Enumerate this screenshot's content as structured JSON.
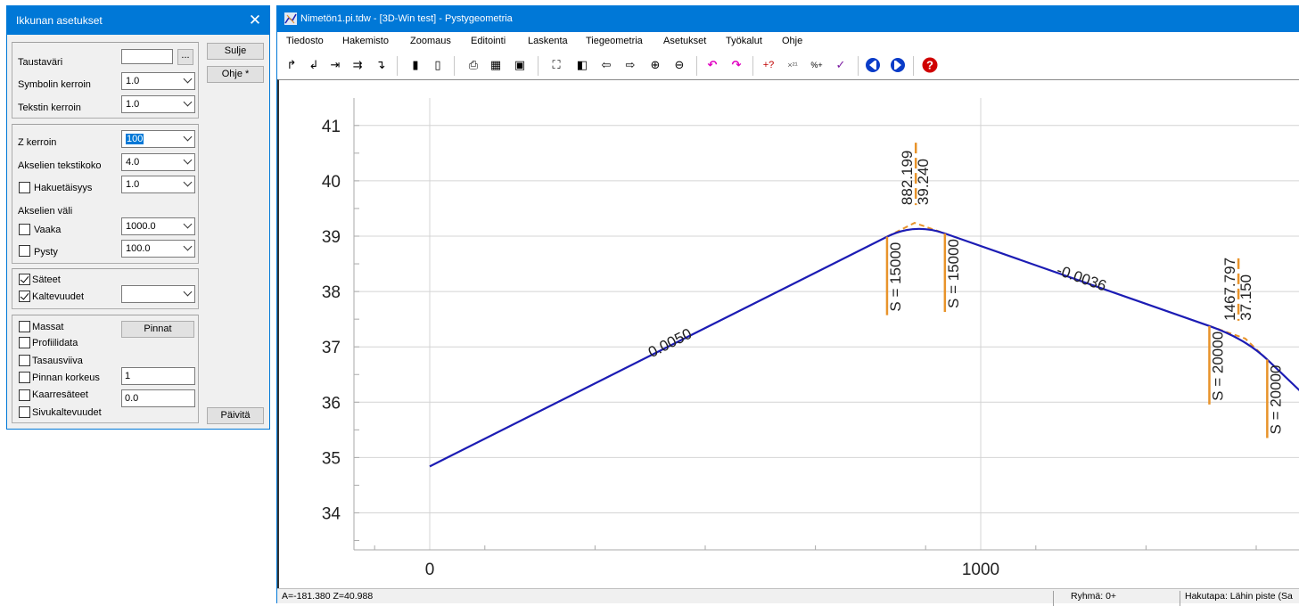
{
  "dialog": {
    "title": "Ikkunan asetukset",
    "close_glyph": "✕",
    "buttons": {
      "close": "Sulje",
      "help": "Ohje *",
      "surfaces": "Pinnat",
      "update": "Päivitä"
    },
    "fields": {
      "background_color": {
        "label": "Taustaväri",
        "browse": "..."
      },
      "symbol_factor": {
        "label": "Symbolin kerroin",
        "value": "1.0"
      },
      "text_factor": {
        "label": "Tekstin kerroin",
        "value": "1.0"
      },
      "z_factor": {
        "label": "Z kerroin",
        "value": "100"
      },
      "axis_text_size": {
        "label": "Akselien tekstikoko",
        "value": "4.0"
      },
      "search_distance": {
        "label": "Hakuetäisyys",
        "value": "1.0",
        "checked": false
      },
      "axis_spacing_label": "Akselien väli",
      "horizontal": {
        "label": "Vaaka",
        "value": "1000.0",
        "checked": false
      },
      "vertical": {
        "label": "Pysty",
        "value": "100.0",
        "checked": false
      },
      "radii": {
        "label": "Säteet",
        "checked": true
      },
      "grades": {
        "label": "Kaltevuudet",
        "value": "",
        "checked": true
      },
      "masses": {
        "label": "Massat",
        "checked": false
      },
      "profile_data": {
        "label": "Profiilidata",
        "checked": false
      },
      "levelling_line": {
        "label": "Tasausviiva",
        "checked": false
      },
      "surface_height": {
        "label": "Pinnan korkeus",
        "value": "1",
        "checked": false
      },
      "arc_radii": {
        "label": "Kaarresäteet",
        "value": "0.0",
        "checked": false
      },
      "side_grades": {
        "label": "Sivukaltevuudet",
        "checked": false
      }
    }
  },
  "window": {
    "title": "Nimetön1.pi.tdw - [3D-Win test] - Pystygeometria",
    "menu": [
      "Tiedosto",
      "Hakemisto",
      "Zoomaus",
      "Editointi",
      "Laskenta",
      "Tiegeometria",
      "Asetukset",
      "Työkalut",
      "Ohje"
    ],
    "status": {
      "coords": "A=-181.380  Z=40.988",
      "group": "Ryhmä: 0+",
      "snap": "Hakutapa: Lähin piste (Sa"
    }
  },
  "colors": {
    "accent": "#0078d7",
    "alignment": "#1c1cb4",
    "annotation": "#e8932a",
    "help_icon": "#d00000",
    "undo": "#e000c0"
  },
  "chart_data": {
    "type": "line",
    "x": [
      0,
      880,
      1480,
      1580
    ],
    "y": [
      34.84,
      39.24,
      37.15,
      36.2
    ],
    "xlim": [
      -140,
      1580
    ],
    "ylim": [
      33.3,
      41.3
    ],
    "xticks": [
      0,
      1000
    ],
    "yticks": [
      34,
      35,
      36,
      37,
      38,
      39,
      40,
      41
    ],
    "grid": true,
    "grade_labels": [
      {
        "text": "0.0050",
        "x": 440,
        "y": 36.99
      },
      {
        "text": "-0.0036",
        "x": 1180,
        "y": 38.16
      }
    ],
    "pvis": [
      {
        "station": "882.199",
        "elevation": "39.240",
        "radius_text": "S = 15000",
        "x": 882.199,
        "y": 39.24,
        "tangent_start": 830,
        "tangent_end": 935
      },
      {
        "station": "1467.797",
        "elevation": "37.150",
        "radius_text": "S = 20000",
        "x": 1467.797,
        "y": 37.15,
        "tangent_start": 1415,
        "tangent_end": 1520
      }
    ]
  }
}
